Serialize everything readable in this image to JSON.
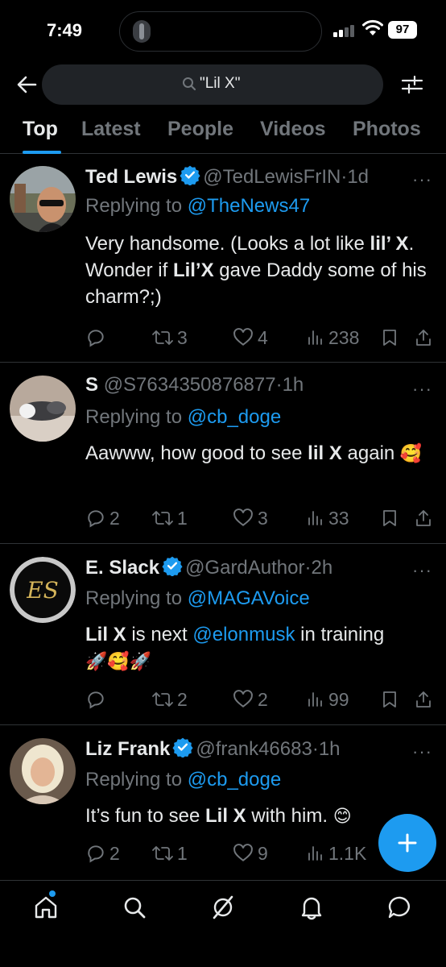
{
  "status_bar": {
    "time": "7:49",
    "battery": "97"
  },
  "search": {
    "query": "\"Lil X\""
  },
  "tabs": [
    "Top",
    "Latest",
    "People",
    "Videos",
    "Photos"
  ],
  "tweets": [
    {
      "name": "Ted Lewis",
      "verified": true,
      "handle": "@TedLewisFrIN",
      "time": "1d",
      "reply_prefix": "Replying to",
      "reply_to": "@TheNews47",
      "body": {
        "t1": "Very handsome. (Looks a lot like ",
        "b1": "lil’ X",
        "t2": ".  Wonder if ",
        "b2": "Lil’X",
        "t3": " gave Daddy some of his charm?;)"
      },
      "stats": {
        "replies": "",
        "reposts": "3",
        "likes": "4",
        "views": "238"
      }
    },
    {
      "name": "S",
      "verified": false,
      "handle": "@S7634350876877",
      "time": "1h",
      "reply_prefix": "Replying to",
      "reply_to": "@cb_doge",
      "body": {
        "t1": "Aawww, how good to see ",
        "b1": "lil X",
        "t2": " again ",
        "emoji": "🥰"
      },
      "stats": {
        "replies": "2",
        "reposts": "1",
        "likes": "3",
        "views": "33"
      }
    },
    {
      "name": "E. Slack",
      "verified": true,
      "handle": "@GardAuthor",
      "time": "2h",
      "reply_prefix": "Replying to",
      "reply_to": "@MAGAVoice",
      "body": {
        "b1": "Lil X",
        "t1": " is next ",
        "mention": "@elonmusk",
        "t2": "  in training ",
        "emoji": "🚀🥰🚀"
      },
      "stats": {
        "replies": "",
        "reposts": "2",
        "likes": "2",
        "views": "99"
      }
    },
    {
      "name": "Liz Frank",
      "verified": true,
      "handle": "@frank46683",
      "time": "1h",
      "reply_prefix": "Replying to",
      "reply_to": "@cb_doge",
      "body": {
        "t1": "It’s fun to see ",
        "b1": "Lil X",
        "t2": " with him. ",
        "emoji": "😊"
      },
      "stats": {
        "replies": "2",
        "reposts": "1",
        "likes": "9",
        "views": "1.1K"
      }
    }
  ],
  "nav": [
    "home-icon",
    "search-icon",
    "grok-icon",
    "notifications-icon",
    "messages-icon"
  ],
  "colors": {
    "accent": "#1d9bf0",
    "muted": "#71767b",
    "background": "#000000",
    "divider": "#2f3336"
  }
}
